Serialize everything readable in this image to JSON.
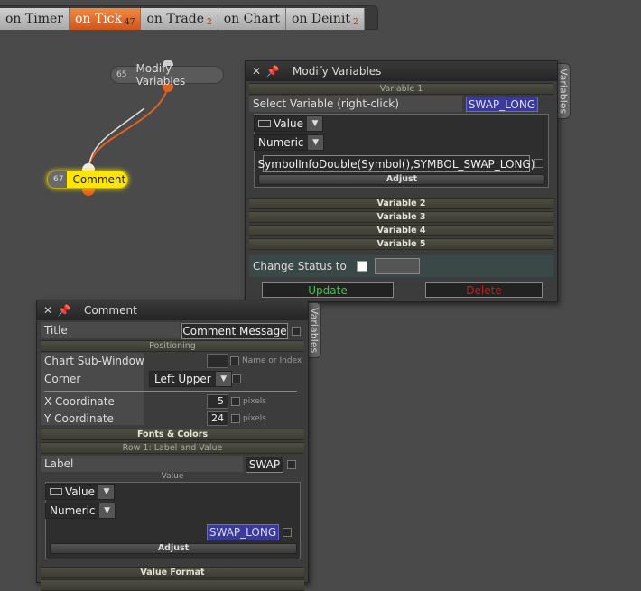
{
  "tabs": [
    {
      "label": "on Timer",
      "badge": "",
      "active": false
    },
    {
      "label": "on Tick",
      "badge": "47",
      "active": true
    },
    {
      "label": "on Trade",
      "badge": "2",
      "active": false
    },
    {
      "label": "on Chart",
      "badge": "",
      "active": false
    },
    {
      "label": "on Deinit",
      "badge": "2",
      "active": false
    }
  ],
  "nodes": {
    "modify": {
      "num": "65",
      "label": "Modify Variables"
    },
    "comment": {
      "num": "67",
      "label": "Comment"
    }
  },
  "modify_panel": {
    "title": "Modify Variables",
    "side_tab": "Variables",
    "variable1": "Variable 1",
    "select_label": "Select Variable (right-click)",
    "select_value": "SWAP_LONG",
    "type_value": "Value",
    "type_numeric": "Numeric",
    "expression": "SymbolInfoDouble(Symbol(),SYMBOL_SWAP_LONG)",
    "adjust": "Adjust",
    "variable2": "Variable 2",
    "variable3": "Variable 3",
    "variable4": "Variable 4",
    "variable5": "Variable 5",
    "change_status": "Change Status to",
    "update": "Update",
    "delete": "Delete"
  },
  "comment_panel": {
    "title": "Comment",
    "side_tab": "Variables",
    "title_label": "Title",
    "title_value": "Comment Message",
    "positioning": "Positioning",
    "subwindow_label": "Chart Sub-Window",
    "subwindow_hint": "Name or Index",
    "corner_label": "Corner",
    "corner_value": "Left Upper",
    "x_label": "X Coordinate",
    "x_value": "5",
    "x_unit": "pixels",
    "y_label": "Y Coordinate",
    "y_value": "24",
    "y_unit": "pixels",
    "fonts": "Fonts & Colors",
    "row1": "Row 1: Label and Value",
    "label_label": "Label",
    "label_value": "SWAP",
    "value_section": "Value",
    "type_value": "Value",
    "type_numeric": "Numeric",
    "var_value": "SWAP_LONG",
    "adjust": "Adjust",
    "value_format": "Value Format"
  },
  "colors": {
    "accent": "#e0682a",
    "update": "#3ec83e",
    "delete": "#d01818",
    "select": "#3a3a9a"
  }
}
